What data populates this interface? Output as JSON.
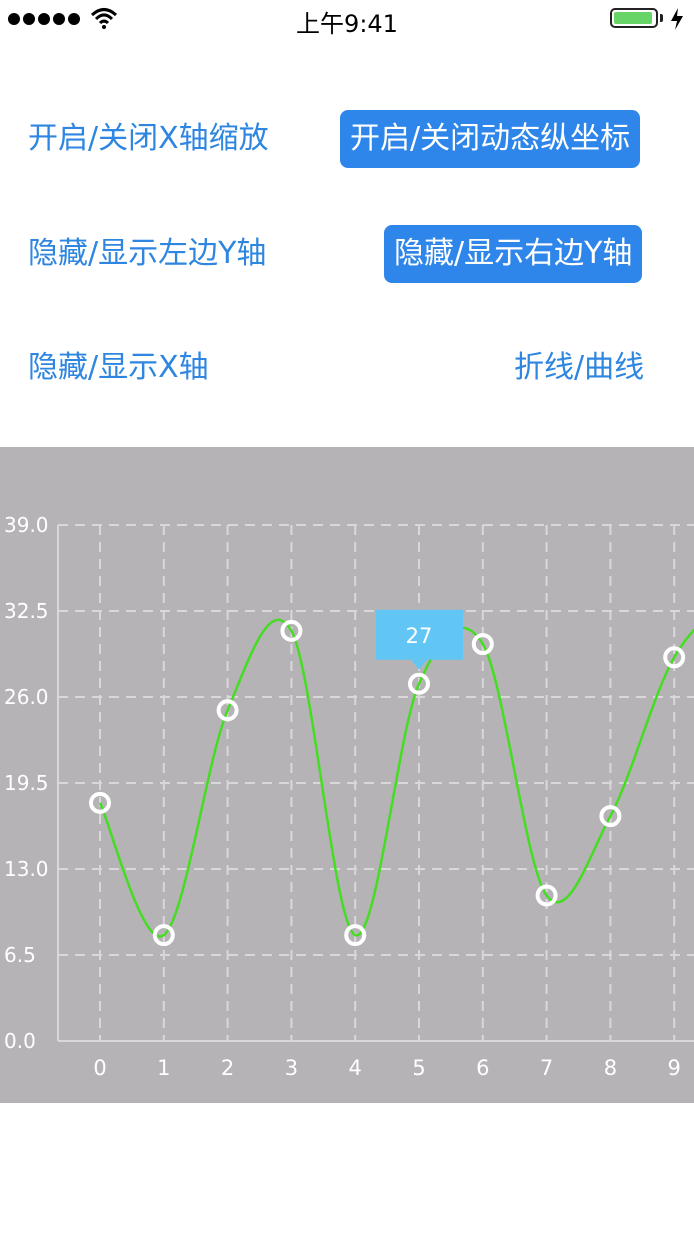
{
  "status_bar": {
    "time": "上午9:41",
    "signal_bars": 5,
    "battery_level": 0.95,
    "icons": [
      "signal-icon",
      "wifi-icon",
      "battery-icon",
      "charging-bolt-icon"
    ]
  },
  "controls": {
    "toggle_x_zoom": "开启/关闭X轴缩放",
    "toggle_dynamic_y": "开启/关闭动态纵坐标",
    "toggle_left_y": "隐藏/显示左边Y轴",
    "toggle_right_y": "隐藏/显示右边Y轴",
    "toggle_x_axis": "隐藏/显示X轴",
    "line_curve": "折线/曲线"
  },
  "colors": {
    "accent": "#2e86ea",
    "chart_bg": "#b6b3b6",
    "line": "#44dd22",
    "tooltip": "#62c6f4"
  },
  "chart_data": {
    "type": "line",
    "x": [
      "0",
      "1",
      "2",
      "3",
      "4",
      "5",
      "6",
      "7",
      "8",
      "9"
    ],
    "series": [
      {
        "values": [
          18,
          8,
          25,
          31,
          8,
          27,
          30,
          11,
          17,
          29
        ]
      }
    ],
    "yticks": [
      "0.0",
      "6.5",
      "13.0",
      "19.5",
      "26.0",
      "32.5",
      "39.0"
    ],
    "ylim": [
      0,
      39
    ],
    "grid": true,
    "smooth": true,
    "selected_index": 5,
    "tooltip_text": "27"
  }
}
